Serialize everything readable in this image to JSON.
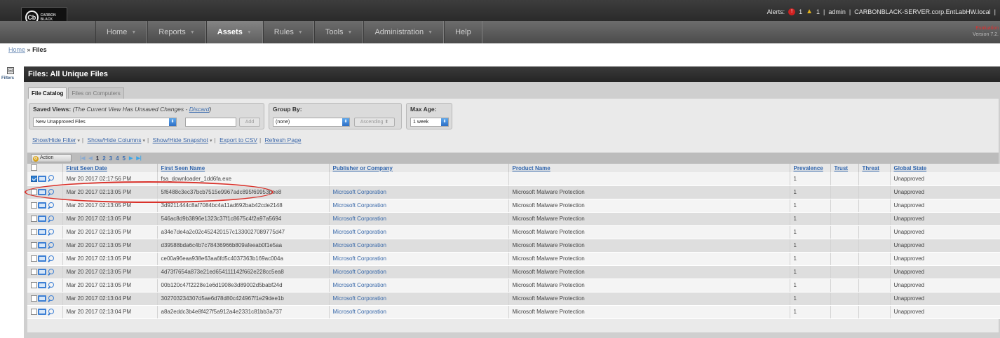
{
  "brand": {
    "logo_mark": "Cb",
    "logo_text": "CARBON BLACK"
  },
  "nav": {
    "tabs": [
      {
        "label": "Home",
        "active": false
      },
      {
        "label": "Reports",
        "active": false
      },
      {
        "label": "Assets",
        "active": true
      },
      {
        "label": "Rules",
        "active": false
      },
      {
        "label": "Tools",
        "active": false
      },
      {
        "label": "Administration",
        "active": false
      },
      {
        "label": "Help",
        "active": false
      }
    ]
  },
  "header": {
    "alerts_label": "Alerts:",
    "alert_red_count": "1",
    "alert_yellow_count": "1",
    "sep": "|",
    "user": "admin",
    "server": "CARBONBLACK-SERVER.corp.EntLabHW.local",
    "evaluation": "Evaluation",
    "version": "Version 7.2."
  },
  "breadcrumb": {
    "home": "Home",
    "sep": "»",
    "current": "Files"
  },
  "sidebar": {
    "toggle": "⊟",
    "label": "Filters"
  },
  "panel": {
    "title": "Files: All Unique Files"
  },
  "tabs": [
    {
      "label": "File Catalog",
      "active": true
    },
    {
      "label": "Files on Computers",
      "active": false
    }
  ],
  "controls": {
    "saved_views_label": "Saved Views:",
    "unsaved_note": "(The Current View Has Unsaved Changes - ",
    "discard": "Discard",
    "unsaved_close": ")",
    "saved_view_value": "New Unapproved Files",
    "add_button": "Add",
    "group_by_label": "Group By:",
    "group_by_value": "(none)",
    "sort_value": "Ascending",
    "max_age_label": "Max Age:",
    "max_age_value": "1 week"
  },
  "links": {
    "show_hide_filter": "Show/Hide Filter",
    "show_hide_columns": "Show/Hide Columns",
    "show_hide_snapshot": "Show/Hide Snapshot",
    "export_csv": "Export to CSV",
    "refresh": "Refresh Page"
  },
  "toolbar": {
    "action": "Action",
    "pages": [
      "1",
      "2",
      "3",
      "4",
      "5"
    ],
    "current_page": "1"
  },
  "table": {
    "columns": [
      "First Seen Date",
      "First Seen Name",
      "Publisher or Company",
      "Product Name",
      "Prevalence",
      "Trust",
      "Threat",
      "Global State"
    ],
    "rows": [
      {
        "checked": true,
        "date": "Mar 20 2017 02:17:56 PM",
        "name": "fsa_downloader_1dd6fa.exe",
        "publisher": "",
        "product": "",
        "prevalence": "1",
        "trust": "",
        "threat": "",
        "state": "Unapproved"
      },
      {
        "checked": false,
        "date": "Mar 20 2017 02:13:05 PM",
        "name": "5f6488c3ec37bcb7515e9967adc895f69953bee8",
        "publisher": "Microsoft Corporation",
        "product": "Microsoft Malware Protection",
        "prevalence": "1",
        "trust": "",
        "threat": "",
        "state": "Unapproved"
      },
      {
        "checked": false,
        "date": "Mar 20 2017 02:13:05 PM",
        "name": "3d9211444c8af7084bc4a11ad692bab42cde2148",
        "publisher": "Microsoft Corporation",
        "product": "Microsoft Malware Protection",
        "prevalence": "1",
        "trust": "",
        "threat": "",
        "state": "Unapproved"
      },
      {
        "checked": false,
        "date": "Mar 20 2017 02:13:05 PM",
        "name": "546ac8d9b3896e1323c37f1c8675c4f2a97a5694",
        "publisher": "Microsoft Corporation",
        "product": "Microsoft Malware Protection",
        "prevalence": "1",
        "trust": "",
        "threat": "",
        "state": "Unapproved"
      },
      {
        "checked": false,
        "date": "Mar 20 2017 02:13:05 PM",
        "name": "a34e7de4a2c02c452420157c1330027089775d47",
        "publisher": "Microsoft Corporation",
        "product": "Microsoft Malware Protection",
        "prevalence": "1",
        "trust": "",
        "threat": "",
        "state": "Unapproved"
      },
      {
        "checked": false,
        "date": "Mar 20 2017 02:13:05 PM",
        "name": "d39588bda6c4b7c78436966b809afeeab0f1e5aa",
        "publisher": "Microsoft Corporation",
        "product": "Microsoft Malware Protection",
        "prevalence": "1",
        "trust": "",
        "threat": "",
        "state": "Unapproved"
      },
      {
        "checked": false,
        "date": "Mar 20 2017 02:13:05 PM",
        "name": "ce00a96eaa938e63aa6fd5c4037363b169ac004a",
        "publisher": "Microsoft Corporation",
        "product": "Microsoft Malware Protection",
        "prevalence": "1",
        "trust": "",
        "threat": "",
        "state": "Unapproved"
      },
      {
        "checked": false,
        "date": "Mar 20 2017 02:13:05 PM",
        "name": "4d73f7654a873e21ed654111142f662e228cc5ea8",
        "publisher": "Microsoft Corporation",
        "product": "Microsoft Malware Protection",
        "prevalence": "1",
        "trust": "",
        "threat": "",
        "state": "Unapproved"
      },
      {
        "checked": false,
        "date": "Mar 20 2017 02:13:05 PM",
        "name": "00b120c47f2228e1e6d1908e3d89002d5babf24d",
        "publisher": "Microsoft Corporation",
        "product": "Microsoft Malware Protection",
        "prevalence": "1",
        "trust": "",
        "threat": "",
        "state": "Unapproved"
      },
      {
        "checked": false,
        "date": "Mar 20 2017 02:13:04 PM",
        "name": "302703234307d5ae6d78d80c424967f1e29dee1b",
        "publisher": "Microsoft Corporation",
        "product": "Microsoft Malware Protection",
        "prevalence": "1",
        "trust": "",
        "threat": "",
        "state": "Unapproved"
      },
      {
        "checked": false,
        "date": "Mar 20 2017 02:13:04 PM",
        "name": "a8a2eddc3b4e8f427f5a912a4e2331c81bb3a737",
        "publisher": "Microsoft Corporation",
        "product": "Microsoft Malware Protection",
        "prevalence": "1",
        "trust": "",
        "threat": "",
        "state": "Unapproved"
      }
    ]
  },
  "colors": {
    "accent": "#2f64ac",
    "highlight": "#d9322b",
    "topbar": "#262626"
  }
}
